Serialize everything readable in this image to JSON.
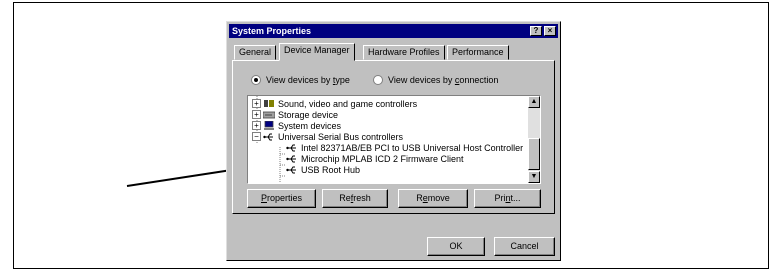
{
  "dialog": {
    "title": "System Properties",
    "help_label": "?",
    "close_label": "×"
  },
  "tabs": [
    "General",
    "Device Manager",
    "Hardware Profiles",
    "Performance"
  ],
  "view": {
    "by_type": {
      "pre": "View devices by ",
      "key": "t",
      "post": "ype"
    },
    "by_connection": {
      "pre": "View devices by ",
      "key": "c",
      "post": "onnection"
    },
    "selected": "by_type"
  },
  "tree_items": [
    {
      "label": "Sound, video and game controllers",
      "expander": "+",
      "icon": "sound-icon"
    },
    {
      "label": "Storage device",
      "expander": "+",
      "icon": "storage-icon"
    },
    {
      "label": "System devices",
      "expander": "+",
      "icon": "computer-icon"
    },
    {
      "label": "Universal Serial Bus controllers",
      "expander": "−",
      "icon": "usb-icon"
    },
    {
      "label": "Intel 82371AB/EB PCI to USB Universal Host Controller",
      "expander": "",
      "icon": "usb-icon"
    },
    {
      "label": "Microchip MPLAB ICD 2 Firmware Client",
      "expander": "",
      "icon": "usb-icon"
    },
    {
      "label": "USB Root Hub",
      "expander": "",
      "icon": "usb-icon"
    }
  ],
  "buttons": {
    "properties": {
      "key": "P",
      "rest": "roperties"
    },
    "refresh": {
      "pre": "Re",
      "key": "f",
      "post": "resh"
    },
    "remove": {
      "pre": "R",
      "key": "e",
      "post": "move"
    },
    "print": {
      "pre": "Pri",
      "key": "n",
      "post": "t..."
    },
    "ok": "OK",
    "cancel": "Cancel"
  }
}
